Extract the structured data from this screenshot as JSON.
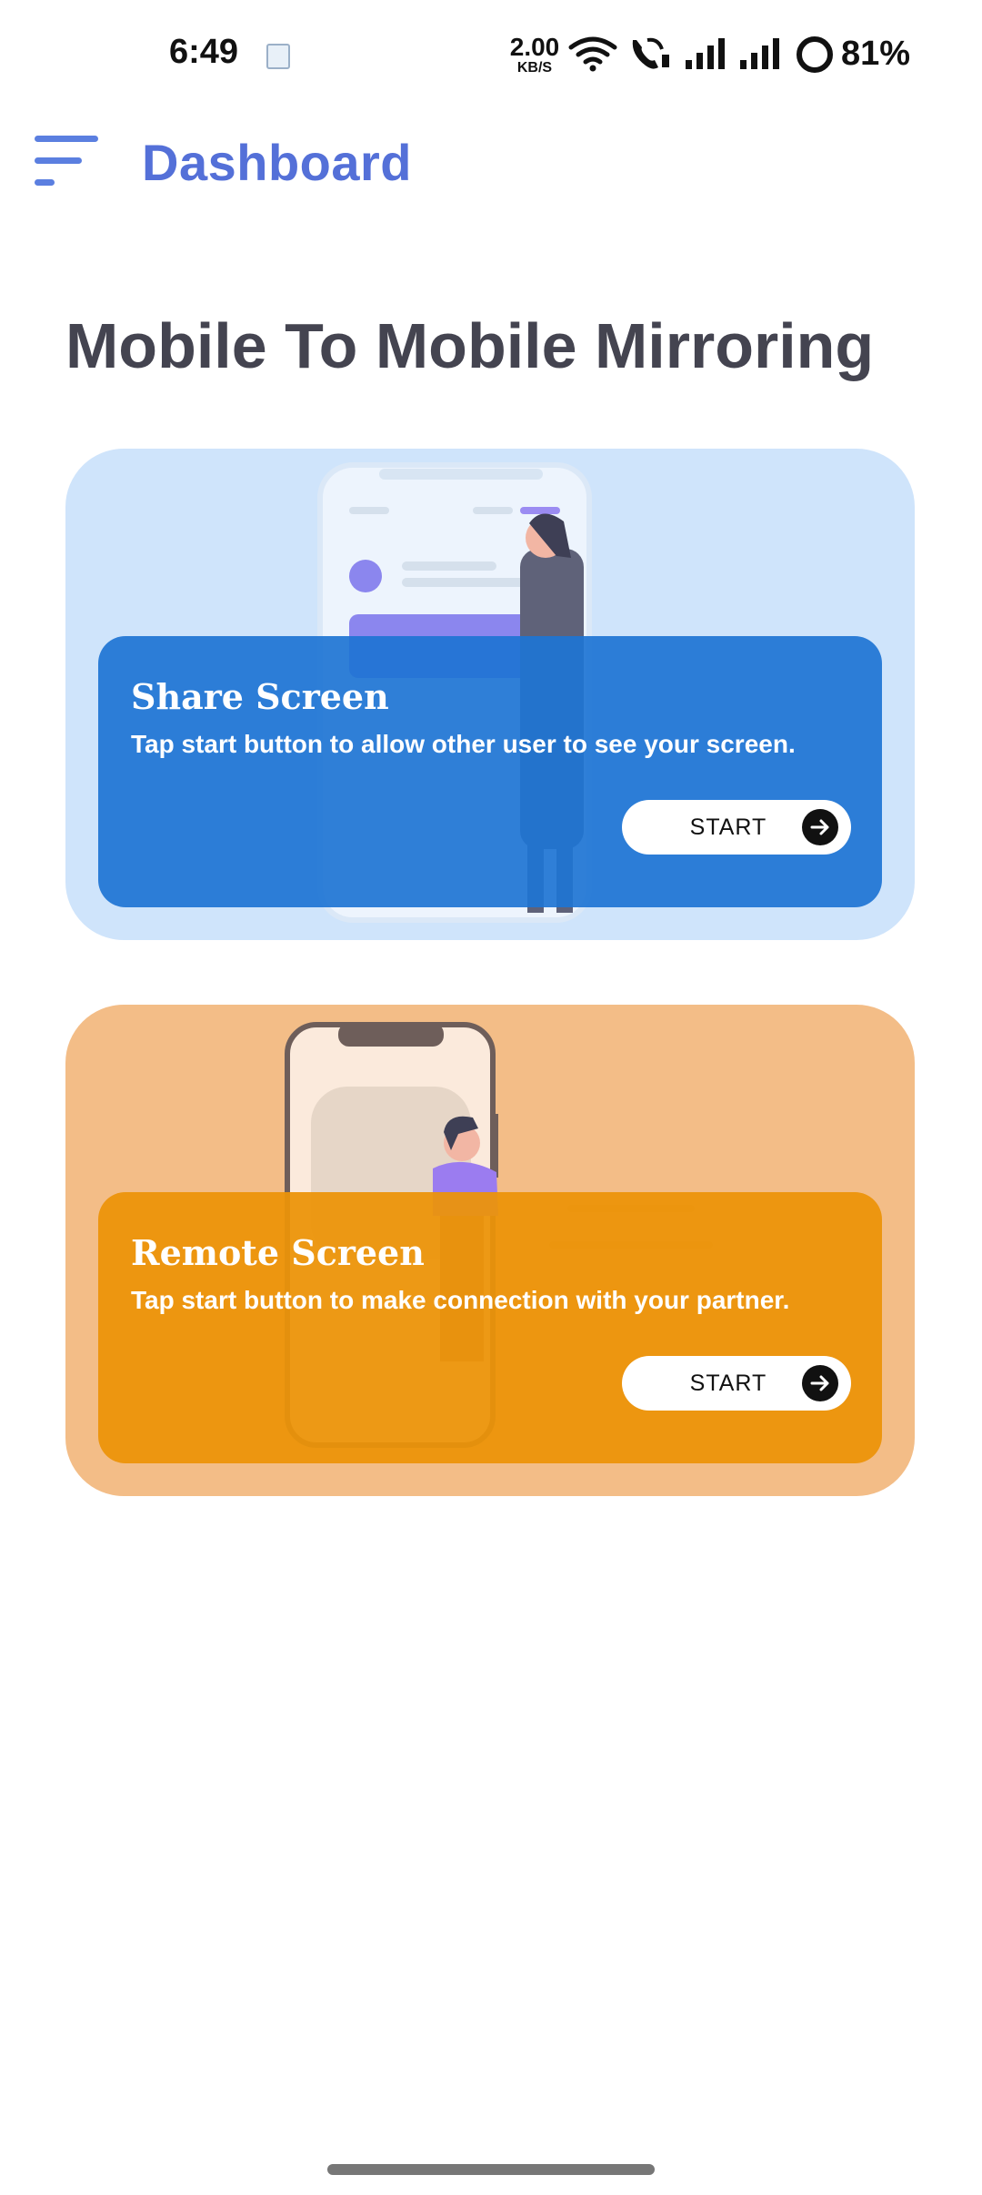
{
  "status_bar": {
    "time": "6:49",
    "net_speed_value": "2.00",
    "net_speed_unit": "KB/S",
    "battery_percent": "81%"
  },
  "app_bar": {
    "title": "Dashboard"
  },
  "page": {
    "title": "Mobile To Mobile Mirroring"
  },
  "cards": [
    {
      "title": "Share Screen",
      "description": "Tap start button to allow other user to see your screen.",
      "button_label": "START"
    },
    {
      "title": "Remote Screen",
      "description": "Tap start button to make connection with your partner.",
      "button_label": "START"
    }
  ],
  "colors": {
    "accent": "#5470d8",
    "share_card_bg": "#cfe4fb",
    "share_panel": "#1e74d4",
    "remote_card_bg": "#f3bd87",
    "remote_panel": "#ec9408"
  }
}
